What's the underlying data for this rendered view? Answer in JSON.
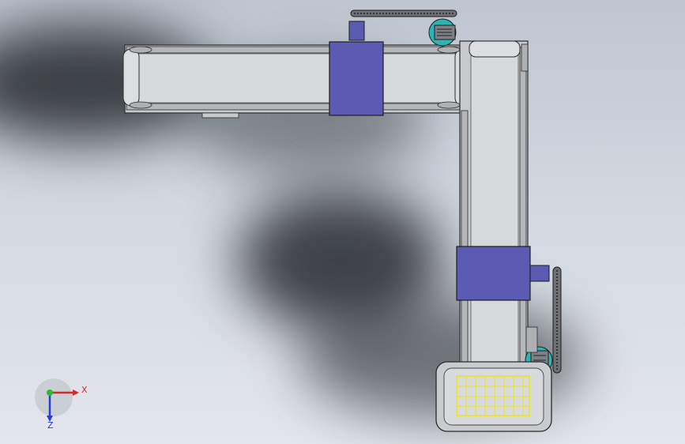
{
  "colors": {
    "frame": "#c7c9cc",
    "frame_stroke": "#2b2b2b",
    "belt": "#d8d9dc",
    "blue_block": "#5b5bb3",
    "motor_teal": "#2fb4b4",
    "cage_yellow": "#e8e23a",
    "background": "#cfd4dc"
  },
  "triad": {
    "x_label": "X",
    "z_label": "Z",
    "x_color": "#d32b2b",
    "z_color": "#2b3bd3",
    "origin_color": "#2fb830"
  }
}
